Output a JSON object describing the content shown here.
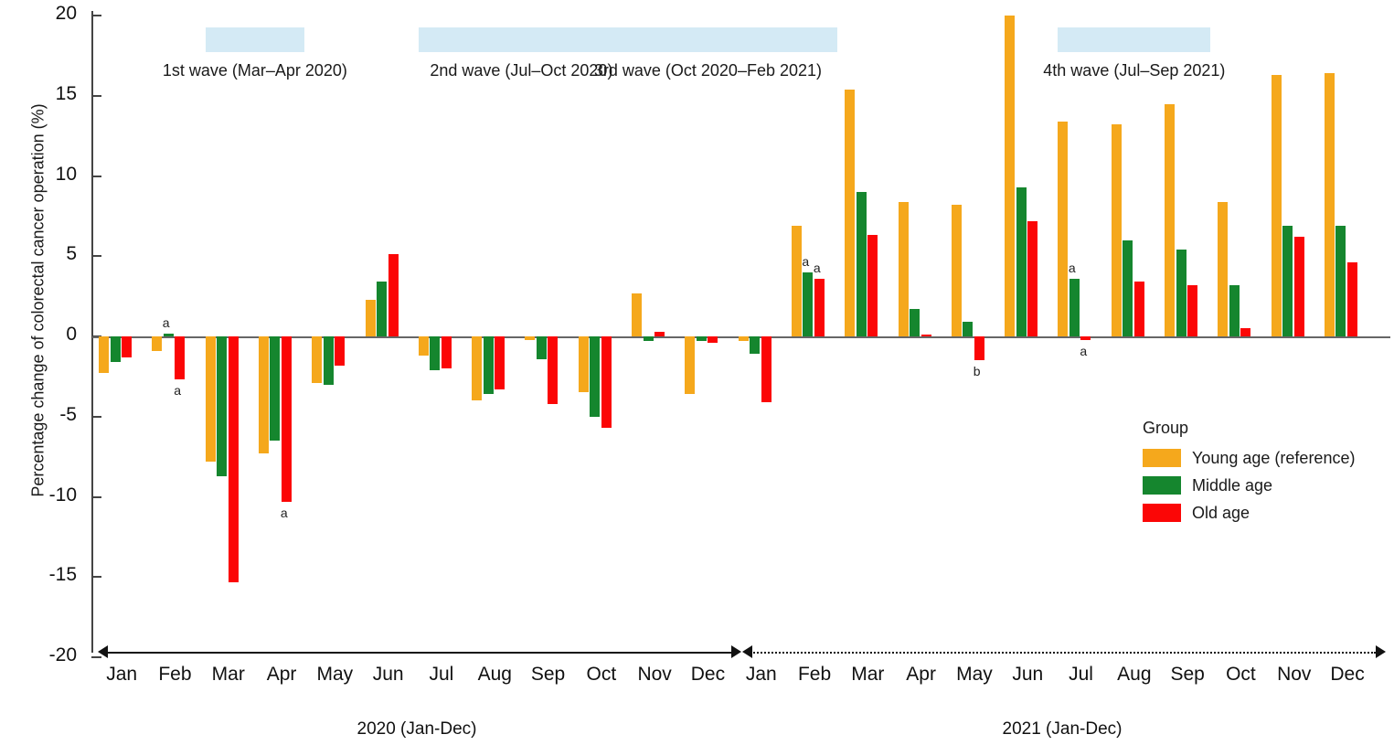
{
  "chart_data": {
    "type": "bar",
    "title": "",
    "xlabel": "",
    "ylabel": "Percentage change of colorectal cancer operation (%)",
    "ylim": [
      -20,
      20
    ],
    "yticks": [
      20,
      15,
      10,
      5,
      0,
      -5,
      -10,
      -15,
      -20
    ],
    "ytick_labels": [
      "20",
      "15",
      "10",
      "5",
      "0",
      "-5",
      "-10",
      "-15",
      "-20"
    ],
    "grid": false,
    "legend_position": "right-inside",
    "legend_title": "Group",
    "categories": [
      "Jan",
      "Feb",
      "Mar",
      "Apr",
      "May",
      "Jun",
      "Jul",
      "Aug",
      "Sep",
      "Oct",
      "Nov",
      "Dec",
      "Jan",
      "Feb",
      "Mar",
      "Apr",
      "May",
      "Jun",
      "Jul",
      "Aug",
      "Sep",
      "Oct",
      "Nov",
      "Dec"
    ],
    "period_labels": [
      "2020 (Jan-Dec)",
      "2021 (Jan-Dec)"
    ],
    "series": [
      {
        "name": "Young age (reference)",
        "color": "#F5A81C",
        "values": [
          -2.3,
          -0.9,
          -7.8,
          -7.3,
          -2.9,
          2.3,
          -1.2,
          -4.0,
          -0.2,
          -3.5,
          2.7,
          -3.6,
          -0.3,
          6.9,
          15.4,
          8.4,
          8.2,
          20.0,
          13.4,
          13.2,
          14.5,
          8.4,
          16.3,
          16.4
        ]
      },
      {
        "name": "Middle age",
        "color": "#15862E",
        "values": [
          -1.6,
          0.15,
          -8.7,
          -6.5,
          -3.0,
          3.4,
          -2.1,
          -3.6,
          -1.4,
          -5.0,
          -0.3,
          -0.3,
          -1.1,
          4.0,
          9.0,
          1.7,
          0.9,
          9.3,
          3.6,
          6.0,
          5.4,
          3.2,
          6.9,
          6.9
        ]
      },
      {
        "name": "Old age",
        "color": "#FB0606",
        "values": [
          -1.3,
          -2.7,
          -15.3,
          -10.3,
          -1.8,
          5.1,
          -2.0,
          -3.3,
          -4.2,
          -5.7,
          0.3,
          -0.4,
          -4.1,
          3.6,
          6.3,
          0.1,
          -1.5,
          7.2,
          -0.2,
          3.4,
          3.2,
          0.5,
          6.2,
          4.6
        ]
      }
    ],
    "annotations": [
      {
        "text": "a",
        "category_index": 1,
        "series": "Middle age",
        "position": "above"
      },
      {
        "text": "a",
        "category_index": 1,
        "series": "Old age",
        "position": "below"
      },
      {
        "text": "a",
        "category_index": 3,
        "series": "Old age",
        "position": "below"
      },
      {
        "text": "a",
        "category_index": 13,
        "series": "Middle age",
        "position": "above"
      },
      {
        "text": "a",
        "category_index": 13,
        "series": "Old age",
        "position": "above"
      },
      {
        "text": "b",
        "category_index": 16,
        "series": "Old age",
        "position": "below"
      },
      {
        "text": "a",
        "category_index": 18,
        "series": "Middle age",
        "position": "above"
      },
      {
        "text": "a",
        "category_index": 18,
        "series": "Old age",
        "position": "below"
      }
    ],
    "wave_bands": [
      {
        "label": "1st wave (Mar–Apr 2020)",
        "start_category": 2,
        "end_category": 3
      },
      {
        "label": "2nd wave (Jul–Oct 2020)",
        "start_category": 6,
        "end_category": 9
      },
      {
        "label": "3rd wave (Oct 2020–Feb 2021)",
        "start_category": 9,
        "end_category": 13
      },
      {
        "label": "4th wave (Jul–Sep 2021)",
        "start_category": 18,
        "end_category": 20
      }
    ],
    "colors": {
      "young": "#F5A81C",
      "middle": "#15862E",
      "old": "#FB0606",
      "wave_band": "#d4eaf5",
      "axis": "#444444"
    }
  },
  "legend": {
    "title": "Group",
    "items": [
      {
        "label": "Young age (reference)",
        "key": "young"
      },
      {
        "label": "Middle age",
        "key": "middle"
      },
      {
        "label": "Old age",
        "key": "old"
      }
    ]
  },
  "axes": {
    "y_title": "Percentage change of colorectal cancer operation (%)",
    "x_period_left": "2020 (Jan-Dec)",
    "x_period_right": "2021 (Jan-Dec)"
  }
}
